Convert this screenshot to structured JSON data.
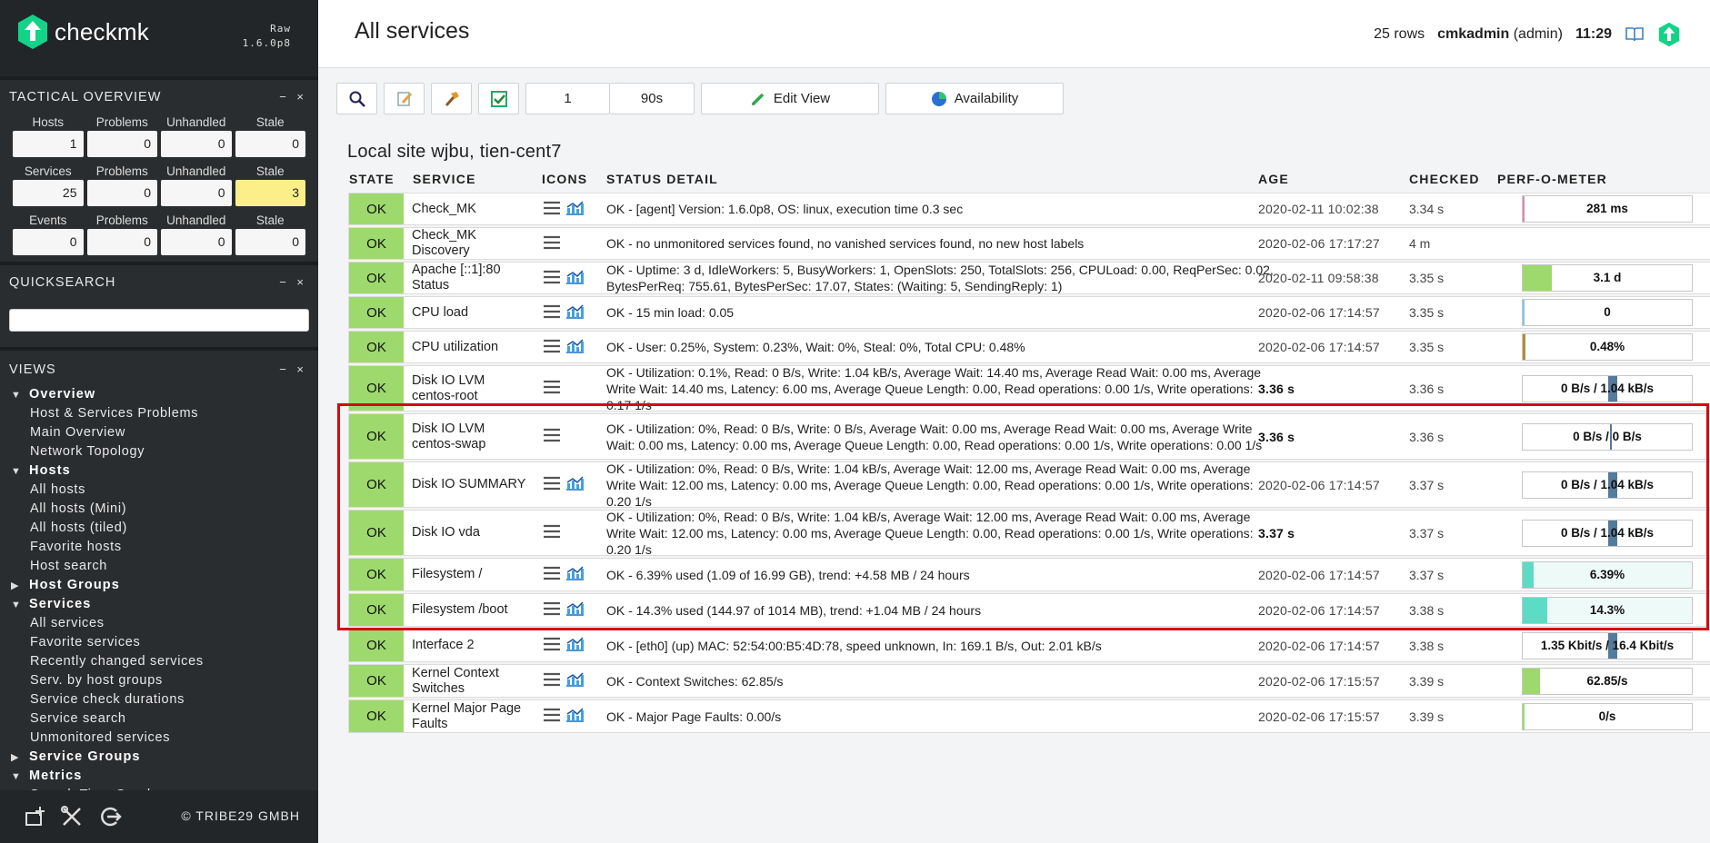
{
  "app": {
    "brand": "checkmk",
    "edition": "Raw",
    "version": "1.6.0p8",
    "accent": "#13d389"
  },
  "sidebar": {
    "tactical": {
      "title": "TACTICAL OVERVIEW",
      "controls": "− ×",
      "headers": [
        [
          "Hosts",
          "Problems",
          "Unhandled",
          "Stale"
        ],
        [
          "Services",
          "Problems",
          "Unhandled",
          "Stale"
        ],
        [
          "Events",
          "Problems",
          "Unhandled",
          "Stale"
        ]
      ],
      "values": [
        [
          "1",
          "0",
          "0",
          "0"
        ],
        [
          "25",
          "0",
          "0",
          "3"
        ],
        [
          "0",
          "0",
          "0",
          "0"
        ]
      ]
    },
    "quicksearch": {
      "title": "QUICKSEARCH",
      "controls": "− ×",
      "value": ""
    },
    "views": {
      "title": "VIEWS",
      "controls": "− ×",
      "items": [
        {
          "type": "group",
          "open": true,
          "label": "Overview"
        },
        {
          "type": "item",
          "label": "Host & Services Problems"
        },
        {
          "type": "item",
          "label": "Main Overview"
        },
        {
          "type": "item",
          "label": "Network Topology"
        },
        {
          "type": "group",
          "open": true,
          "label": "Hosts"
        },
        {
          "type": "item",
          "label": "All hosts"
        },
        {
          "type": "item",
          "label": "All hosts (Mini)"
        },
        {
          "type": "item",
          "label": "All hosts (tiled)"
        },
        {
          "type": "item",
          "label": "Favorite hosts"
        },
        {
          "type": "item",
          "label": "Host search"
        },
        {
          "type": "group",
          "open": false,
          "label": "Host Groups"
        },
        {
          "type": "group",
          "open": true,
          "label": "Services"
        },
        {
          "type": "item",
          "label": "All services"
        },
        {
          "type": "item",
          "label": "Favorite services"
        },
        {
          "type": "item",
          "label": "Recently changed services"
        },
        {
          "type": "item",
          "label": "Serv. by host groups"
        },
        {
          "type": "item",
          "label": "Service check durations"
        },
        {
          "type": "item",
          "label": "Service search"
        },
        {
          "type": "item",
          "label": "Unmonitored services"
        },
        {
          "type": "group",
          "open": false,
          "label": "Service Groups"
        },
        {
          "type": "group",
          "open": true,
          "label": "Metrics"
        },
        {
          "type": "item",
          "label": "Search Time Graphs"
        }
      ]
    },
    "footer": {
      "copyright": "© TRIBE29 GMBH"
    }
  },
  "header": {
    "title": "All services",
    "rows": "25 rows",
    "user": "cmkadmin",
    "role": "(admin)",
    "time": "11:29"
  },
  "toolbar": {
    "refresh_count": "1",
    "refresh_interval": "90s",
    "edit_view": "Edit View",
    "availability": "Availability"
  },
  "site": {
    "title": "Local site wjbu, tien-cent7"
  },
  "table": {
    "columns": [
      "STATE",
      "SERVICE",
      "ICONS",
      "STATUS DETAIL",
      "AGE",
      "CHECKED",
      "PERF-O-METER"
    ],
    "rows": [
      {
        "state": "OK",
        "service": "Check_MK",
        "graph": true,
        "detail": "OK - [agent] Version: 1.6.0p8, OS: linux, execution time 0.3 sec",
        "age": "2020-02-11 10:02:38",
        "age_bold": false,
        "checked": "3.34 s",
        "perf": "281 ms",
        "fill": 0.01,
        "fill_color": "#d88ab3",
        "meter_style": "bar"
      },
      {
        "state": "OK",
        "service": "Check_MK Discovery",
        "graph": false,
        "detail": "OK - no unmonitored services found, no vanished services found, no new host labels",
        "age": "2020-02-06 17:17:27",
        "age_bold": false,
        "checked": "4 m",
        "perf": "",
        "fill": 0,
        "fill_color": "",
        "meter_style": "none"
      },
      {
        "state": "OK",
        "service": "Apache [::1]:80 Status",
        "graph": true,
        "detail": "OK - Uptime: 3 d, IdleWorkers: 5, BusyWorkers: 1, OpenSlots: 250, TotalSlots: 256, CPULoad: 0.00, ReqPerSec: 0.02, BytesPerReq: 755.61, BytesPerSec: 17.07, States: (Waiting: 5, SendingReply: 1)",
        "age": "2020-02-11 09:58:38",
        "age_bold": false,
        "checked": "3.35 s",
        "perf": "3.1 d",
        "fill": 0.17,
        "fill_color": "#9ed96e",
        "meter_style": "bar"
      },
      {
        "state": "OK",
        "service": "CPU load",
        "graph": true,
        "detail": "OK - 15 min load: 0.05",
        "age": "2020-02-06 17:14:57",
        "age_bold": false,
        "checked": "3.35 s",
        "perf": "0",
        "fill": 0.005,
        "fill_color": "#7fc9e8",
        "meter_style": "bar"
      },
      {
        "state": "OK",
        "service": "CPU utilization",
        "graph": true,
        "detail": "OK - User: 0.25%, System: 0.23%, Wait: 0%, Steal: 0%, Total CPU: 0.48%",
        "age": "2020-02-06 17:14:57",
        "age_bold": false,
        "checked": "3.35 s",
        "perf": "0.48%",
        "fill": 0.015,
        "fill_color": "#b58b3e",
        "meter_style": "bar"
      },
      {
        "state": "OK",
        "service": "Disk IO LVM centos-root",
        "graph": false,
        "detail": "OK - Utilization: 0.1%, Read: 0 B/s, Write: 1.04 kB/s, Average Wait: 14.40 ms, Average Read Wait: 0.00 ms, Average Write Wait: 14.40 ms, Latency: 6.00 ms, Average Queue Length: 0.00, Read operations: 0.00 1/s, Write operations: 0.17 1/s",
        "age": "3.36 s",
        "age_bold": true,
        "checked": "3.36 s",
        "perf": "0 B/s / 1.04 kB/s",
        "fill": 0,
        "fill_color": "",
        "meter_style": "mid"
      },
      {
        "state": "OK",
        "service": "Disk IO LVM centos-swap",
        "graph": false,
        "detail": "OK - Utilization: 0%, Read: 0 B/s, Write: 0 B/s, Average Wait: 0.00 ms, Average Read Wait: 0.00 ms, Average Write Wait: 0.00 ms, Latency: 0.00 ms, Average Queue Length: 0.00, Read operations: 0.00 1/s, Write operations: 0.00 1/s",
        "age": "3.36 s",
        "age_bold": true,
        "checked": "3.36 s",
        "perf": "0 B/s / 0 B/s",
        "fill": 0,
        "fill_color": "",
        "meter_style": "line"
      },
      {
        "state": "OK",
        "service": "Disk IO SUMMARY",
        "graph": true,
        "detail": "OK - Utilization: 0%, Read: 0 B/s, Write: 1.04 kB/s, Average Wait: 12.00 ms, Average Read Wait: 0.00 ms, Average Write Wait: 12.00 ms, Latency: 0.00 ms, Average Queue Length: 0.00, Read operations: 0.00 1/s, Write operations: 0.20 1/s",
        "age": "2020-02-06 17:14:57",
        "age_bold": false,
        "checked": "3.37 s",
        "perf": "0 B/s / 1.04 kB/s",
        "fill": 0,
        "fill_color": "",
        "meter_style": "mid"
      },
      {
        "state": "OK",
        "service": "Disk IO vda",
        "graph": false,
        "detail": "OK - Utilization: 0%, Read: 0 B/s, Write: 1.04 kB/s, Average Wait: 12.00 ms, Average Read Wait: 0.00 ms, Average Write Wait: 12.00 ms, Latency: 0.00 ms, Average Queue Length: 0.00, Read operations: 0.00 1/s, Write operations: 0.20 1/s",
        "age": "3.37 s",
        "age_bold": true,
        "checked": "3.37 s",
        "perf": "0 B/s / 1.04 kB/s",
        "fill": 0,
        "fill_color": "",
        "meter_style": "mid"
      },
      {
        "state": "OK",
        "service": "Filesystem /",
        "graph": true,
        "detail": "OK - 6.39% used (1.09 of 16.99 GB), trend: +4.58 MB / 24 hours",
        "age": "2020-02-06 17:14:57",
        "age_bold": false,
        "checked": "3.37 s",
        "perf": "6.39%",
        "fill": 0.064,
        "fill_color": "#5cdbc5",
        "meter_style": "fs"
      },
      {
        "state": "OK",
        "service": "Filesystem /boot",
        "graph": true,
        "detail": "OK - 14.3% used (144.97 of 1014 MB), trend: +1.04 MB / 24 hours",
        "age": "2020-02-06 17:14:57",
        "age_bold": false,
        "checked": "3.38 s",
        "perf": "14.3%",
        "fill": 0.143,
        "fill_color": "#5cdbc5",
        "meter_style": "fs"
      },
      {
        "state": "OK",
        "service": "Interface 2",
        "graph": true,
        "detail": "OK - [eth0] (up) MAC: 52:54:00:B5:4D:78, speed unknown, In: 169.1 B/s, Out: 2.01 kB/s",
        "age": "2020-02-06 17:14:57",
        "age_bold": false,
        "checked": "3.38 s",
        "perf": "1.35 Kbit/s / 16.4 Kbit/s",
        "fill": 0,
        "fill_color": "",
        "meter_style": "mid"
      },
      {
        "state": "OK",
        "service": "Kernel Context Switches",
        "graph": true,
        "detail": "OK - Context Switches: 62.85/s",
        "age": "2020-02-06 17:15:57",
        "age_bold": false,
        "checked": "3.39 s",
        "perf": "62.85/s",
        "fill": 0.1,
        "fill_color": "#9ed96e",
        "meter_style": "bar"
      },
      {
        "state": "OK",
        "service": "Kernel Major Page Faults",
        "graph": true,
        "detail": "OK - Major Page Faults: 0.00/s",
        "age": "2020-02-06 17:15:57",
        "age_bold": false,
        "checked": "3.39 s",
        "perf": "0/s",
        "fill": 0.005,
        "fill_color": "#9ed96e",
        "meter_style": "bar"
      }
    ]
  }
}
